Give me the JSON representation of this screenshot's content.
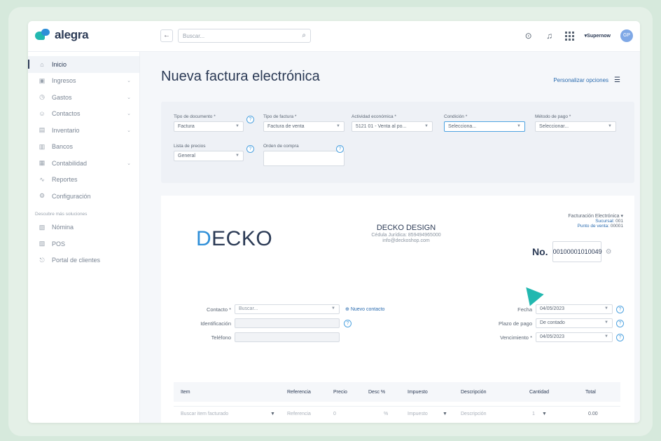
{
  "topbar": {
    "logo_text": "alegra",
    "back_symbol": "←",
    "search_placeholder": "Buscar...",
    "company_name": "▾Supernow",
    "avatar_initials": "GP"
  },
  "sidebar": {
    "items": [
      {
        "label": "Inicio",
        "icon": "home-icon",
        "glyph": "⌂",
        "active": true
      },
      {
        "label": "Ingresos",
        "icon": "income-icon",
        "glyph": "▣",
        "chevron": true
      },
      {
        "label": "Gastos",
        "icon": "expenses-icon",
        "glyph": "◷",
        "chevron": true
      },
      {
        "label": "Contactos",
        "icon": "contacts-icon",
        "glyph": "☺",
        "chevron": true
      },
      {
        "label": "Inventario",
        "icon": "inventory-icon",
        "glyph": "▤",
        "chevron": true
      },
      {
        "label": "Bancos",
        "icon": "bank-icon",
        "glyph": "▥"
      },
      {
        "label": "Contabilidad",
        "icon": "accounting-icon",
        "glyph": "▦",
        "chevron": true
      },
      {
        "label": "Reportes",
        "icon": "reports-icon",
        "glyph": "∿"
      },
      {
        "label": "Configuración",
        "icon": "settings-icon",
        "glyph": "⚙"
      }
    ],
    "section_title": "Descubre más soluciones",
    "extra_items": [
      {
        "label": "Nómina",
        "icon": "payroll-icon",
        "glyph": "▧"
      },
      {
        "label": "POS",
        "icon": "pos-icon",
        "glyph": "▨"
      },
      {
        "label": "Portal de clientes",
        "icon": "portal-icon",
        "glyph": "⎋"
      }
    ]
  },
  "main": {
    "title": "Nueva factura electrónica",
    "customize_label": "Personalizar opciones"
  },
  "form": {
    "doc_type": {
      "label": "Tipo de documento *",
      "value": "Factura"
    },
    "invoice_type": {
      "label": "Tipo de factura *",
      "value": "Factura de venta"
    },
    "economic_activity": {
      "label": "Actividad económica *",
      "value": "5121 01 - Venta al po..."
    },
    "condition": {
      "label": "Condición *",
      "value": "Selecciona..."
    },
    "payment_method": {
      "label": "Método de pago *",
      "value": "Seleccionar..."
    },
    "price_list": {
      "label": "Lista de precios",
      "value": "General"
    },
    "purchase_order": {
      "label": "Orden de compra",
      "value": ""
    }
  },
  "invoice": {
    "logo_prefix": "D",
    "logo_rest": "ECKO",
    "company_name": "DECKO DESIGN",
    "company_id": "Cédula Jurídica: 859494965000",
    "company_email": "info@deckoshop.com",
    "numbering_type": "Facturación Electrónica ▾",
    "branch_label": "Sucursal:",
    "branch_value": "001",
    "pos_label": "Punto de venta:",
    "pos_value": "00001",
    "number_label": "No.",
    "number_value": "00100001010049"
  },
  "client": {
    "contact_label": "Contacto *",
    "contact_placeholder": "Buscar...",
    "new_contact_label": "Nuevo contacto",
    "id_label": "Identificación",
    "phone_label": "Teléfono",
    "date_label": "Fecha",
    "date_value": "04/05/2023",
    "term_label": "Plazo de pago",
    "term_value": "De contado",
    "due_label": "Vencimiento *",
    "due_value": "04/05/2023"
  },
  "table": {
    "headers": [
      "Item",
      "Referencia",
      "Precio",
      "Desc %",
      "Impuesto",
      "Descripción",
      "Cantidad",
      "Total"
    ],
    "row": {
      "item": "Buscar item facturado",
      "reference": "Referencia",
      "price": "0",
      "discount": "%",
      "tax": "Impuesto",
      "description": "Descripción",
      "quantity": "1",
      "total": "0.00"
    }
  }
}
